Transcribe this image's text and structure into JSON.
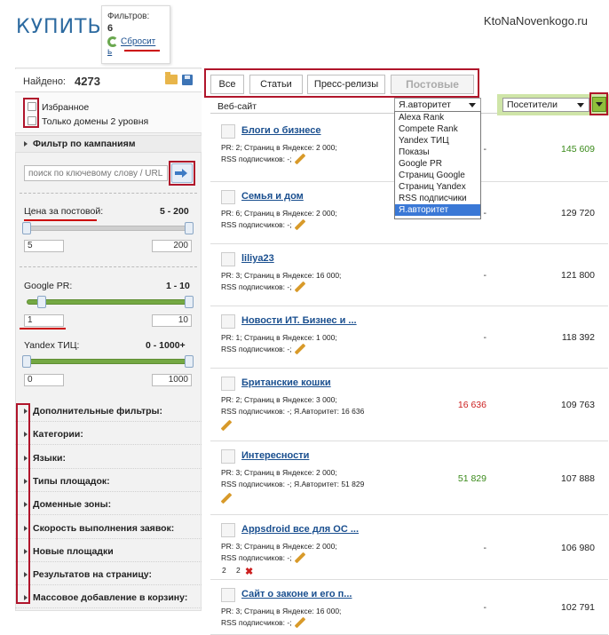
{
  "header": {
    "title": "КУПИТЬ",
    "filters_label": "Фильтров:",
    "filters_count": "6",
    "reset_link": "Сбросит",
    "reset_link_wrap": "ь",
    "site_logo": "KtoNaNovenkogo.ru"
  },
  "sidebar": {
    "found_label": "Найдено:",
    "found_value": "4273",
    "checkbox_favorites": "Избранное",
    "checkbox_domains": "Только домены 2 уровня",
    "campaign_filter": "Фильтр по кампаниям",
    "search_placeholder": "поиск по ключевому слову / URL",
    "price": {
      "label": "Цена за постовой:",
      "range": "5 - 200",
      "min": "5",
      "max": "200"
    },
    "google_pr": {
      "label": "Google PR:",
      "range": "1 - 10",
      "min": "1",
      "max": "10"
    },
    "yandex_tic": {
      "label": "Yandex ТИЦ:",
      "range": "0 - 1000+",
      "min": "0",
      "max": "1000"
    },
    "sections": [
      "Дополнительные фильтры:",
      "Категории:",
      "Языки:",
      "Типы площадок:",
      "Доменные зоны:",
      "Скорость выполнения заявок:",
      "Новые площадки",
      "Результатов на страницу:",
      "Массовое добавление в корзину:"
    ]
  },
  "tabs": [
    "Все",
    "Статьи",
    "Пресс-релизы",
    "Постовые"
  ],
  "columns": {
    "site": "Веб-сайт",
    "sort_select": "Я.авторитет",
    "visitors_select": "Посетители"
  },
  "dropdown_options": [
    "Alexa Rank",
    "Compete Rank",
    "Yandex ТИЦ",
    "Показы",
    "Google PR",
    "Страниц Google",
    "Страниц Yandex",
    "RSS подписчики",
    "Я.авторитет"
  ],
  "rows": [
    {
      "title": "Блоги о бизнесе",
      "meta1": "PR: 2; Страниц в Яндексе: 2 000;",
      "meta2": "RSS подписчиков: -;",
      "auth": "-",
      "visitors": "145 609",
      "icon": "number-5-icon"
    },
    {
      "title": "Семья и дом",
      "meta1": "PR: 6; Страниц в Яндексе: 2 000;",
      "meta2": "RSS подписчиков: -;",
      "auth": "-",
      "visitors": "129 720",
      "icon": "family-icon"
    },
    {
      "title": "liliya23",
      "meta1": "PR: 3; Страниц в Яндексе: 16 000;",
      "meta2": "RSS подписчиков: -;",
      "auth": "-",
      "visitors": "121 800",
      "icon": "pencil-pot-icon"
    },
    {
      "title": "Новости ИТ. Бизнес и ...",
      "meta1": "PR: 1; Страниц в Яндексе: 1 000;",
      "meta2": "RSS подписчиков: -;",
      "auth": "-",
      "visitors": "118 392",
      "icon": "globe-icon"
    },
    {
      "title": "Британские кошки",
      "meta1": "PR: 2; Страниц в Яндексе: 3 000;",
      "meta2": "RSS подписчиков: -; Я.Авторитет: 16 636",
      "auth": "16 636",
      "visitors": "109 763",
      "icon": "cat-icon"
    },
    {
      "title": "Интересности",
      "meta1": "PR: 3; Страниц в Яндексе: 2 000;",
      "meta2": "RSS подписчиков: -; Я.Авторитет: 51 829",
      "auth": "51 829",
      "visitors": "107 888",
      "icon": "picture-icon"
    },
    {
      "title": "Appsdroid все для ОС ...",
      "meta1": "PR: 3; Страниц в Яндексе: 2 000;",
      "meta2": "RSS подписчиков: -;",
      "extra1": "2",
      "extra2": "2",
      "auth": "-",
      "visitors": "106 980",
      "icon": "android-icon"
    },
    {
      "title": "Сайт о законе и его п...",
      "meta1": "PR: 3; Страниц в Яндексе: 16 000;",
      "meta2": "RSS подписчиков: -;",
      "auth": "-",
      "visitors": "102 791",
      "icon": "hash-icon"
    }
  ]
}
